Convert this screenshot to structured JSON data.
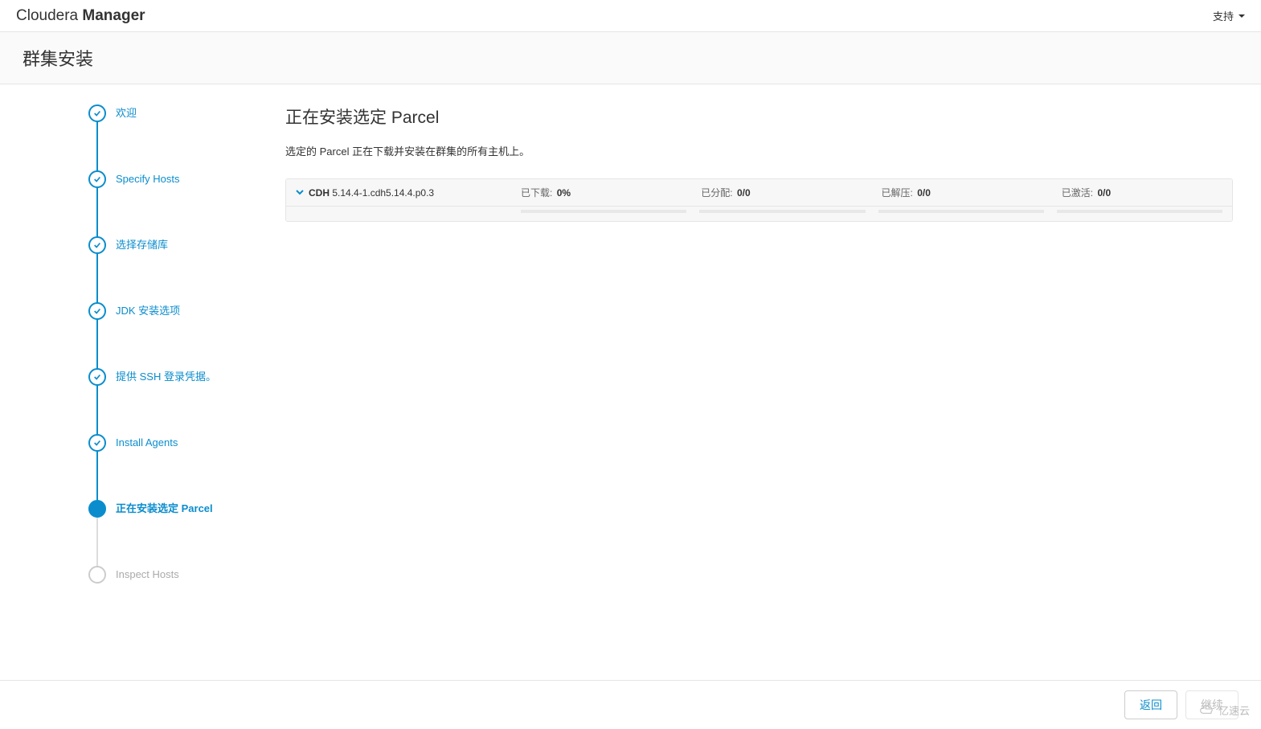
{
  "header": {
    "brand_prefix": "Cloudera ",
    "brand_bold": "Manager",
    "support_label": "支持"
  },
  "page": {
    "title": "群集安装"
  },
  "wizard": {
    "steps": [
      {
        "label": "欢迎",
        "state": "done"
      },
      {
        "label": "Specify Hosts",
        "state": "done"
      },
      {
        "label": "选择存储库",
        "state": "done"
      },
      {
        "label": "JDK 安装选项",
        "state": "done"
      },
      {
        "label": "提供 SSH 登录凭据。",
        "state": "done"
      },
      {
        "label": "Install Agents",
        "state": "done"
      },
      {
        "label": "正在安装选定 Parcel",
        "state": "current"
      },
      {
        "label": "Inspect Hosts",
        "state": "pending"
      }
    ]
  },
  "content": {
    "title": "正在安装选定 Parcel",
    "desc": "选定的 Parcel 正在下载并安装在群集的所有主机上。"
  },
  "parcel": {
    "name_bold": "CDH",
    "name_version": " 5.14.4-1.cdh5.14.4.p0.3",
    "download_label": "已下载:",
    "download_val": "0%",
    "distribute_label": "已分配:",
    "distribute_val": "0/0",
    "unpack_label": "已解压:",
    "unpack_val": "0/0",
    "activate_label": "已激活:",
    "activate_val": "0/0"
  },
  "footer": {
    "back": "返回",
    "continue": "继续"
  },
  "watermark": "亿速云"
}
